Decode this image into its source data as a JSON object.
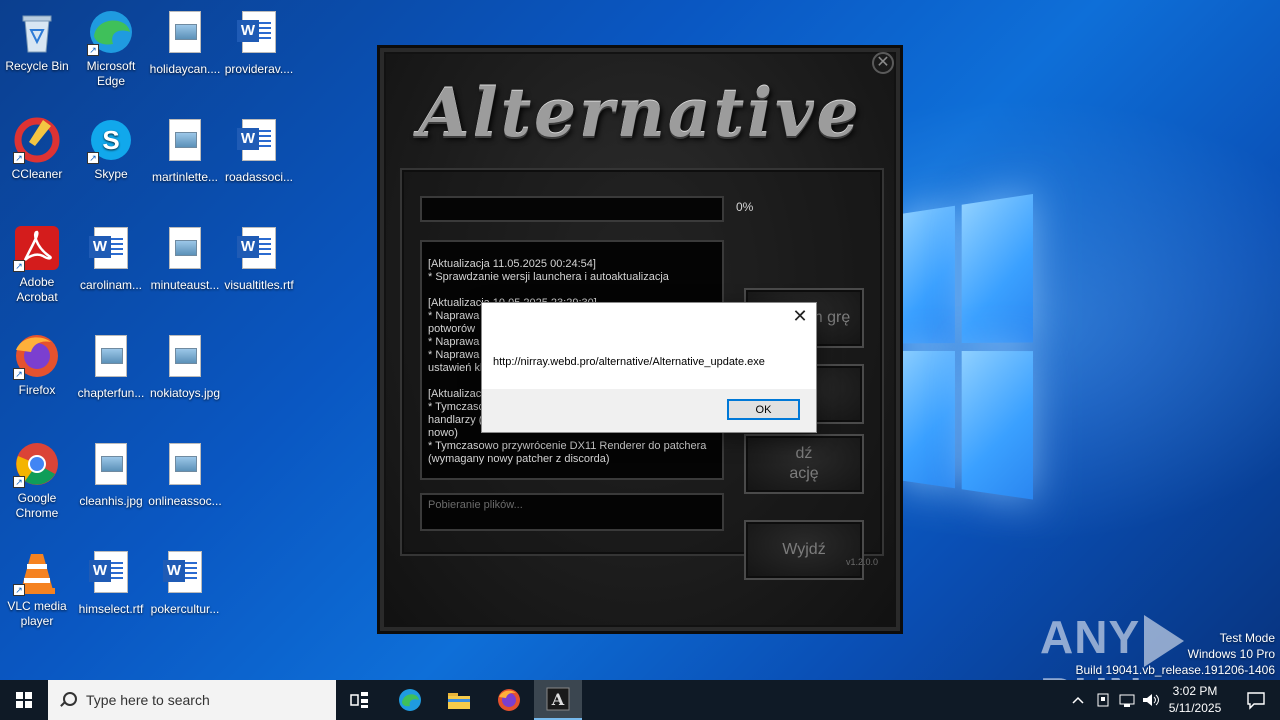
{
  "desktop": {
    "icons": [
      {
        "label": "Recycle Bin",
        "icon": "recycle-bin-icon"
      },
      {
        "label": "Microsoft Edge",
        "icon": "edge-icon"
      },
      {
        "label": "holidaycan....",
        "icon": "image-file-icon"
      },
      {
        "label": "providerav....",
        "icon": "word-file-icon"
      },
      {
        "label": "CCleaner",
        "icon": "ccleaner-icon"
      },
      {
        "label": "Skype",
        "icon": "skype-icon"
      },
      {
        "label": "martinlette...",
        "icon": "image-file-icon"
      },
      {
        "label": "roadassoci...",
        "icon": "word-file-icon"
      },
      {
        "label": "Adobe Acrobat",
        "icon": "acrobat-icon"
      },
      {
        "label": "carolinam...",
        "icon": "word-file-icon"
      },
      {
        "label": "minuteaust...",
        "icon": "image-file-icon"
      },
      {
        "label": "visualtitles.rtf",
        "icon": "word-file-icon"
      },
      {
        "label": "Firefox",
        "icon": "firefox-icon"
      },
      {
        "label": "chapterfun...",
        "icon": "image-file-icon"
      },
      {
        "label": "nokiatoys.jpg",
        "icon": "image-file-icon"
      },
      {
        "label": "Google Chrome",
        "icon": "chrome-icon"
      },
      {
        "label": "cleanhis.jpg",
        "icon": "image-file-icon"
      },
      {
        "label": "onlineassoc...",
        "icon": "image-file-icon"
      },
      {
        "label": "VLC media player",
        "icon": "vlc-icon"
      },
      {
        "label": "himselect.rtf",
        "icon": "word-file-icon"
      },
      {
        "label": "pokercultur...",
        "icon": "word-file-icon"
      }
    ]
  },
  "launcher": {
    "title": "Alternative",
    "progress_percent": "0%",
    "progress_value": 0,
    "log": [
      "[Aktualizacja 11.05.2025 00:24:54]\n* Sprawdzanie wersji launchera i autoaktualizacja",
      "[Aktualizacja 10.05.2025 23:29:30]\n* Naprawa b\npotworów\n* Naprawa b\n* Naprawa b\nustawień kl",
      "[Aktualizacja\n* Tymczaso\nhandlarzy (z\nnowo)\n* Tymczasowo przywrócenie DX11 Renderer do patchera\n(wymagany nowy patcher z discorda)"
    ],
    "status_placeholder": "Pobieranie plików...",
    "buttons": {
      "start": "Uruchom grę",
      "settings": "nia",
      "update": "dź\nację",
      "exit": "Wyjdź"
    },
    "version": "v1.2.0.0",
    "close": "✕"
  },
  "msgbox": {
    "text": "http://nirray.webd.pro/alternative/Alternative_update.exe",
    "ok_label": "OK",
    "close": "✕"
  },
  "watermark": {
    "brand_left": "ANY",
    "brand_right": "RUN",
    "line1": "Test Mode",
    "line2": "Windows 10 Pro",
    "line3": "Build 19041.vb_release.191206-1406"
  },
  "taskbar": {
    "search_placeholder": "Type here to search",
    "time": "3:02 PM",
    "date": "5/11/2025"
  }
}
